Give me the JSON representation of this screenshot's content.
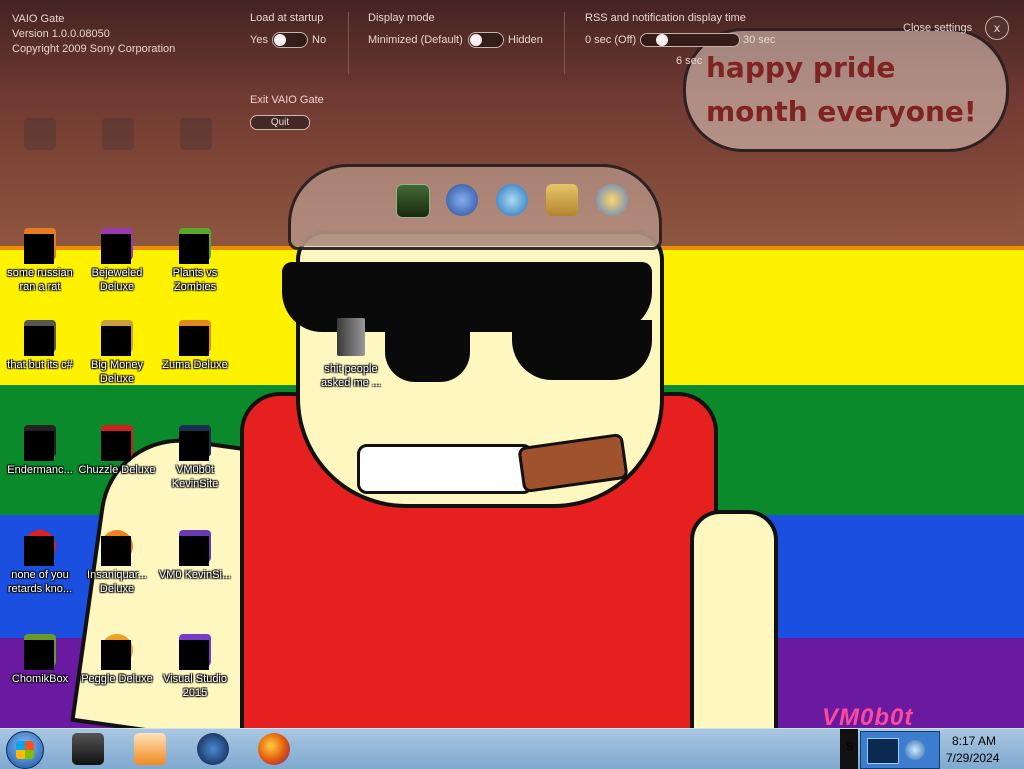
{
  "vaio_gate": {
    "name": "VAIO Gate",
    "version": "Version 1.0.0.08050",
    "copyright": "Copyright 2009 Sony Corporation",
    "load_startup": {
      "label": "Load at startup",
      "left": "Yes",
      "right": "No",
      "on": false
    },
    "display_mode": {
      "label": "Display mode",
      "left": "Minimized (Default)",
      "right": "Hidden",
      "on": false
    },
    "rss": {
      "label": "RSS and notification display time",
      "min": "0 sec (Off)",
      "max": "30 sec",
      "value": "6 sec",
      "fraction": 0.2
    },
    "exit_label": "Exit VAIO Gate",
    "quit_button": "Quit",
    "close_settings": "Close settings",
    "close_icon": "x"
  },
  "dock_icons": [
    "media-icon",
    "web-browser-icon",
    "internet-explorer-icon",
    "mail-icon",
    "people-icon"
  ],
  "wallpaper": {
    "speech_bubble": "happy pride month everyone!",
    "watermark": "VM0b0t",
    "stripe_colors": [
      "#e22016",
      "#fff200",
      "#0a8a2a",
      "#1b4fe0",
      "#6a1aa0"
    ]
  },
  "desktop_icons": [
    {
      "label": "some russian ran a rat",
      "icon": "app-icon"
    },
    {
      "label": "Bejeweled Deluxe",
      "icon": "game-icon"
    },
    {
      "label": "Plants vs Zombies",
      "icon": "game-icon"
    },
    {
      "label": "that but its c#",
      "icon": "shortcut-icon"
    },
    {
      "label": "Big Money Deluxe",
      "icon": "game-icon"
    },
    {
      "label": "Zuma Deluxe",
      "icon": "game-icon"
    },
    {
      "label": "Endermanc...",
      "icon": "app-icon"
    },
    {
      "label": "Chuzzle Deluxe",
      "icon": "game-icon"
    },
    {
      "label": "VM0b0t KevinSite",
      "icon": "app-icon"
    },
    {
      "label": "none of you retards kno...",
      "icon": "app-icon"
    },
    {
      "label": "Insaniquar... Deluxe",
      "icon": "game-icon"
    },
    {
      "label": "VM0 KevinSi...",
      "icon": "app-icon"
    },
    {
      "label": "ChomikBox",
      "icon": "app-icon"
    },
    {
      "label": "Peggle Deluxe",
      "icon": "game-icon"
    },
    {
      "label": "Visual Studio 2015",
      "icon": "visual-studio-icon"
    }
  ],
  "folder": {
    "label": "shit people asked me ..."
  },
  "taskbar": {
    "apps": [
      "terminal-icon",
      "media-player-icon",
      "globe-icon",
      "firefox-icon"
    ],
    "tray_letter": "S",
    "time": "8:17 AM",
    "date": "7/29/2024"
  }
}
